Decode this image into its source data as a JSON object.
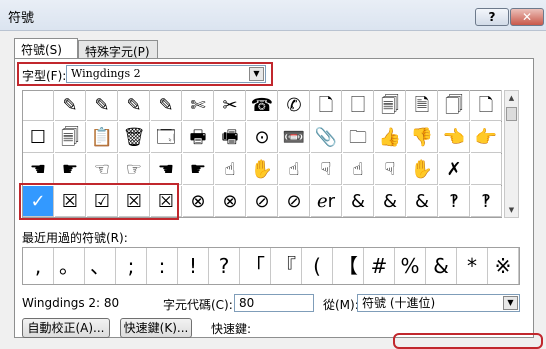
{
  "window": {
    "title": "符號",
    "help_label": "?",
    "close_label": "✕"
  },
  "tabs": [
    {
      "label": "符號(S)"
    },
    {
      "label": "特殊字元(P)"
    }
  ],
  "font": {
    "label": "字型(F):",
    "value": "Wingdings 2"
  },
  "symbols": [
    [
      " ",
      "✎",
      "✎",
      "✎",
      "✎",
      "✄",
      "✂",
      "☎",
      "✆",
      "🗋",
      "🗌",
      "🗐",
      "🗎",
      "🗍",
      "🗋"
    ],
    [
      "☐",
      "🗐",
      "📋",
      "🗑",
      "🗔",
      "🖶",
      "🖷",
      "⊙",
      "📼",
      "📎",
      "🗀",
      "👍",
      "👎",
      "👈",
      "👉"
    ],
    [
      "☚",
      "☛",
      "☜",
      "☞",
      "☚",
      "☛",
      "☝",
      "✋",
      "☝",
      "☟",
      "☝",
      "☟",
      "✋",
      "✗",
      " "
    ],
    [
      "✓",
      "☒",
      "☑",
      "☒",
      "☒",
      "⊗",
      "⊗",
      "⊘",
      "⊘",
      "ℯr",
      "&",
      "&",
      "&",
      "‽",
      "‽",
      "?"
    ]
  ],
  "recent": {
    "label": "最近用過的符號(R):",
    "items": [
      ",",
      "。",
      "、",
      ";",
      ":",
      "!",
      "?",
      "「",
      "『",
      "(",
      "【",
      "#",
      "%",
      "&",
      "*",
      "※"
    ]
  },
  "code_name": "Wingdings 2: 80",
  "char_code": {
    "label": "字元代碼(C):",
    "value": "80"
  },
  "from": {
    "label": "從(M):",
    "value": "符號 (十進位)"
  },
  "buttons": {
    "autocorrect": "自動校正(A)...",
    "shortcut_key": "快速鍵(K)...",
    "shortcut_label": "快速鍵:"
  },
  "colors": {
    "highlight": "#3399ff",
    "annotation": "#c1272d"
  }
}
